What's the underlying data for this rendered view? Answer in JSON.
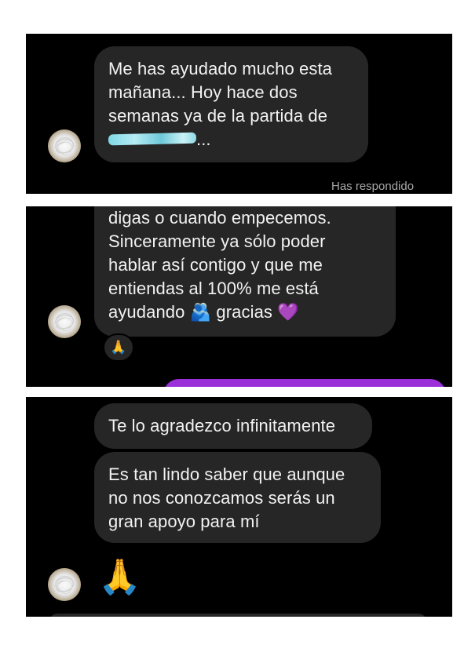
{
  "panel1": {
    "message": {
      "line1": "Me has ayudado mucho esta",
      "line2": "mañana... Hoy hace dos",
      "line3": "semanas ya de la partida de",
      "line4_suffix": "..."
    },
    "status_text": "Has respondido"
  },
  "panel2": {
    "message": {
      "line1": "digas o cuando empecemos.",
      "line2": "Sinceramente ya sólo poder",
      "line3": "hablar así contigo y que me",
      "line4": "entiendas al 100% me está",
      "line5_a": "ayudando",
      "line5_emoji": "🫂",
      "line5_b": "gracias",
      "line5_heart": "💜"
    },
    "reaction": "🙏"
  },
  "panel3": {
    "message1": "Te lo agradezco infinitamente",
    "message2": {
      "line1": "Es tan lindo saber que aunque",
      "line2": "no nos conozcamos serás un",
      "line3": "gran apoyo para mí"
    },
    "emoji": "🙏"
  },
  "colors": {
    "background": "#000000",
    "bubble_incoming": "#262626",
    "bubble_outgoing": "#9b2fd9",
    "status": "#a8a8a8",
    "text": "#f2f2f2"
  }
}
